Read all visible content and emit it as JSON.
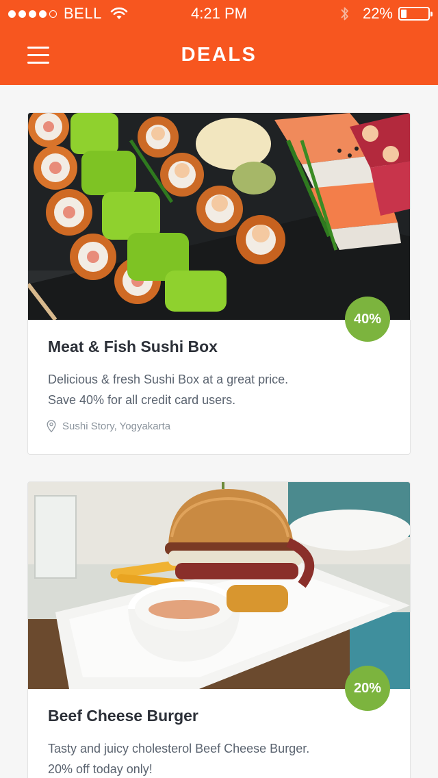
{
  "status_bar": {
    "carrier": "BELL",
    "time": "4:21 PM",
    "battery_percent": "22%",
    "battery_level": 0.22,
    "signal_bars": 4
  },
  "header": {
    "title": "DEALS",
    "color": "#f7561f"
  },
  "deals": [
    {
      "title": "Meat & Fish Sushi Box",
      "description_line1": "Delicious & fresh Sushi Box at a great price.",
      "description_line2": "Save 40% for all credit card users.",
      "location": "Sushi Story, Yogyakarta",
      "discount": "40%"
    },
    {
      "title": "Beef Cheese Burger",
      "description_line1": "Tasty and juicy cholesterol Beef Cheese Burger.",
      "description_line2": "20% off today only!",
      "location": "",
      "discount": "20%"
    }
  ],
  "colors": {
    "badge": "#7cb43e",
    "accent": "#f7561f"
  },
  "icons": {
    "menu": "hamburger-icon",
    "location": "map-pin-icon",
    "wifi": "wifi-icon",
    "bluetooth": "bluetooth-icon",
    "battery": "battery-icon"
  }
}
